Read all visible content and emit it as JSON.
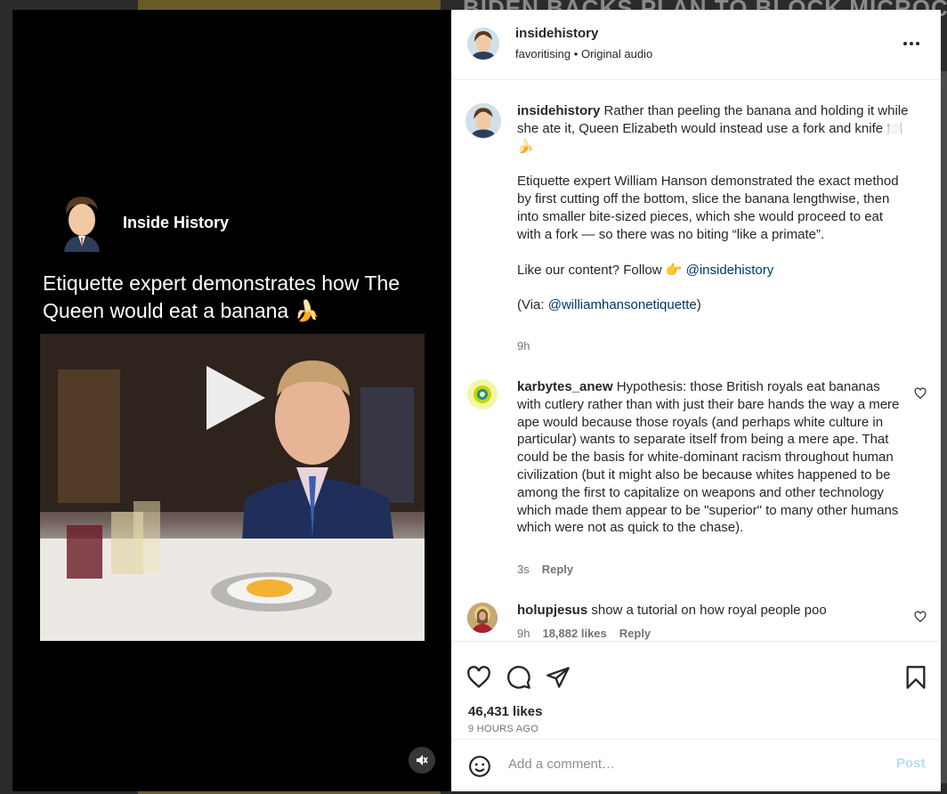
{
  "background": {
    "headline": "BIDEN BACKS PLAN TO BLOCK  MICROCHIP IMPLANT"
  },
  "media": {
    "brand_name": "Inside History",
    "headline": "Etiquette expert demonstrates how The Queen would eat a banana 🍌",
    "mute_icon": "speaker-muted-icon"
  },
  "header": {
    "username": "insidehistory",
    "subtitle_user": "favoritising",
    "subtitle_sep": "•",
    "subtitle_audio": "Original audio"
  },
  "caption": {
    "username": "insidehistory",
    "paragraph1": "Rather than peeling the banana and holding it while she ate it, Queen Elizabeth would instead use a fork and knife 🍽️🍌",
    "paragraph2": "Etiquette expert William Hanson demonstrated the exact method by first cutting off the bottom, slice the banana lengthwise, then into smaller bite-sized pieces, which she would proceed to eat with a fork — so there was no biting “like a primate”.",
    "follow_text": "Like our content? Follow 👉",
    "follow_mention": "@insidehistory",
    "via_prefix": "(Via: ",
    "via_mention": "@williamhansonetiquette",
    "via_suffix": ")",
    "time": "9h"
  },
  "comments": [
    {
      "username": "karbytes_anew",
      "text": "Hypothesis: those British royals eat bananas with cutlery rather than with just their bare hands the way a mere ape would because those royals (and perhaps white culture in particular) wants to separate itself from being a mere ape. That could be the basis for white-dominant racism throughout human civilization (but it might also be because whites happened to be among the first to capitalize on weapons and other technology which made them appear to be \"superior\" to many other humans which were not as quick to the chase).",
      "time": "3s",
      "reply": "Reply"
    },
    {
      "username": "holupjesus",
      "text": "show a tutorial on how royal people poo",
      "time": "9h",
      "likes": "18,882 likes",
      "reply": "Reply"
    }
  ],
  "actions": {
    "likes": "46,431 likes",
    "time": "9 HOURS AGO"
  },
  "add_comment": {
    "placeholder": "Add a comment…",
    "post": "Post"
  }
}
